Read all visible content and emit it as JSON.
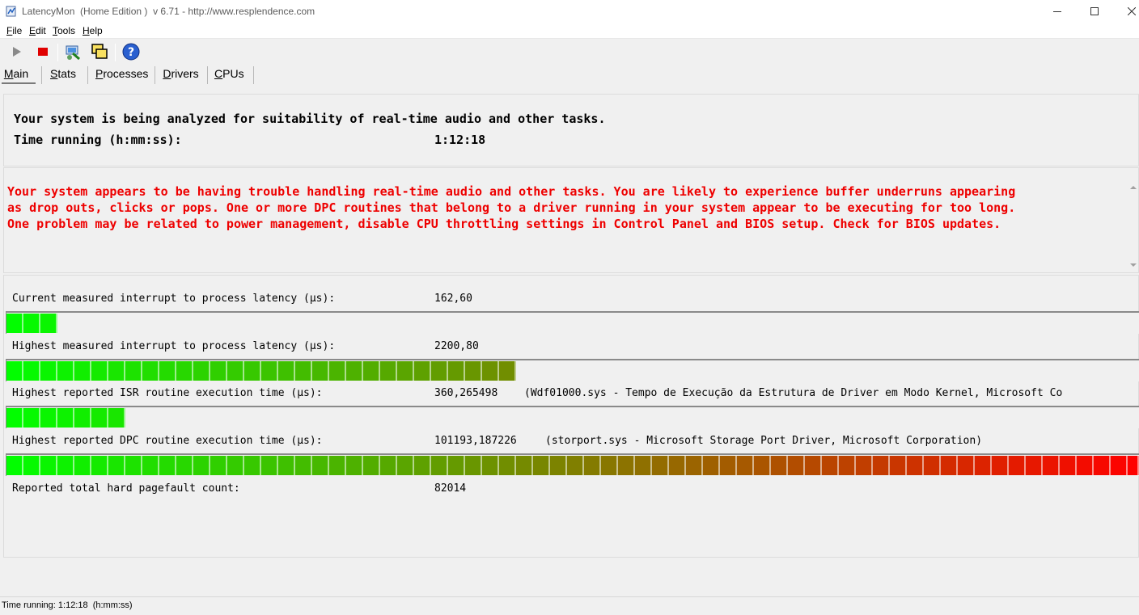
{
  "window": {
    "title": "LatencyMon  (Home Edition )  v 6.71 - http://www.resplendence.com",
    "icon": "latencymon-app-icon"
  },
  "menu": [
    "File",
    "Edit",
    "Tools",
    "Help"
  ],
  "toolbar": {
    "buttons": [
      "play-icon",
      "stop-icon",
      "install-icon",
      "windows-icon",
      "help-icon"
    ]
  },
  "tabs": [
    "Main",
    "Stats",
    "Processes",
    "Drivers",
    "CPUs"
  ],
  "active_tab": "Main",
  "main": {
    "analyze_line": "Your system is being analyzed for suitability of real-time audio and other tasks.",
    "runtime_label": "Time running (h:mm:ss):",
    "runtime_value": "1:12:18",
    "warning": "Your system appears to be having trouble handling real-time audio and other tasks. You are likely to experience buffer underruns appearing\nas drop outs, clicks or pops. One or more DPC routines that belong to a driver running in your system appear to be executing for too long.\nOne problem may be related to power management, disable CPU throttling settings in Control Panel and BIOS setup. Check for BIOS updates.",
    "warning_color": "#ee0000"
  },
  "metrics": [
    {
      "label": "Current measured interrupt to process latency (µs):",
      "value": "162,60",
      "description": "",
      "meter_fraction": 0.044
    },
    {
      "label": "Highest measured interrupt to process latency (µs):",
      "value": "2200,80",
      "description": "",
      "meter_fraction": 0.45
    },
    {
      "label": "Highest reported ISR routine execution time (µs):",
      "value": "360,265498",
      "description": "(Wdf01000.sys - Tempo de Execução da Estrutura de Driver em Modo Kernel, Microsoft Co",
      "meter_fraction": 0.109
    },
    {
      "label": "Highest reported DPC routine execution time (µs):",
      "value": "101193,187226",
      "description": "(storport.sys - Microsoft Storage Port Driver, Microsoft Corporation)",
      "meter_fraction": 1.0
    },
    {
      "label": "Reported total hard pagefault count:",
      "value": "82014",
      "description": ""
    }
  ],
  "meter_colors": {
    "start": "#00ff00",
    "end": "#ff0000"
  },
  "statusbar": {
    "text": "Time running: 1:12:18  (h:mm:ss)"
  }
}
